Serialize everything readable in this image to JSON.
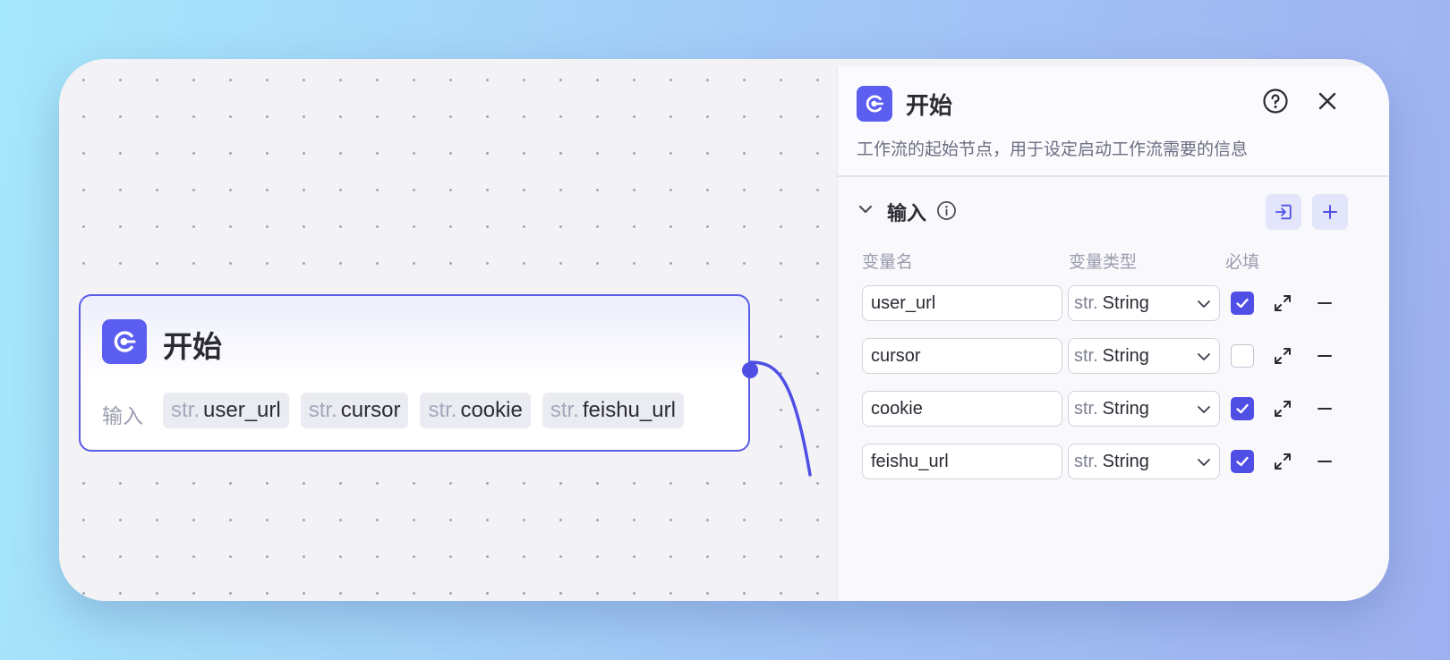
{
  "node": {
    "title": "开始",
    "inputs_label": "输入",
    "chips": [
      {
        "type": "str.",
        "name": "user_url"
      },
      {
        "type": "str.",
        "name": "cursor"
      },
      {
        "type": "str.",
        "name": "cookie"
      },
      {
        "type": "str.",
        "name": "feishu_url"
      }
    ]
  },
  "panel": {
    "title": "开始",
    "description": "工作流的起始节点，用于设定启动工作流需要的信息",
    "section_title": "输入",
    "columns": {
      "name": "变量名",
      "type": "变量类型",
      "required": "必填"
    },
    "rows": [
      {
        "name": "user_url",
        "type_prefix": "str.",
        "type": "String",
        "required": true
      },
      {
        "name": "cursor",
        "type_prefix": "str.",
        "type": "String",
        "required": false
      },
      {
        "name": "cookie",
        "type_prefix": "str.",
        "type": "String",
        "required": true
      },
      {
        "name": "feishu_url",
        "type_prefix": "str.",
        "type": "String",
        "required": true
      }
    ]
  },
  "colors": {
    "accent": "#4f4fe6",
    "logo_bg": "#5b5ef0",
    "canvas_bg": "#f3f3f6"
  },
  "icons": [
    "start-logo-icon",
    "help-icon",
    "close-icon",
    "chevron-down-icon",
    "info-icon",
    "import-icon",
    "plus-icon",
    "expand-icon",
    "minus-icon",
    "check-icon"
  ]
}
